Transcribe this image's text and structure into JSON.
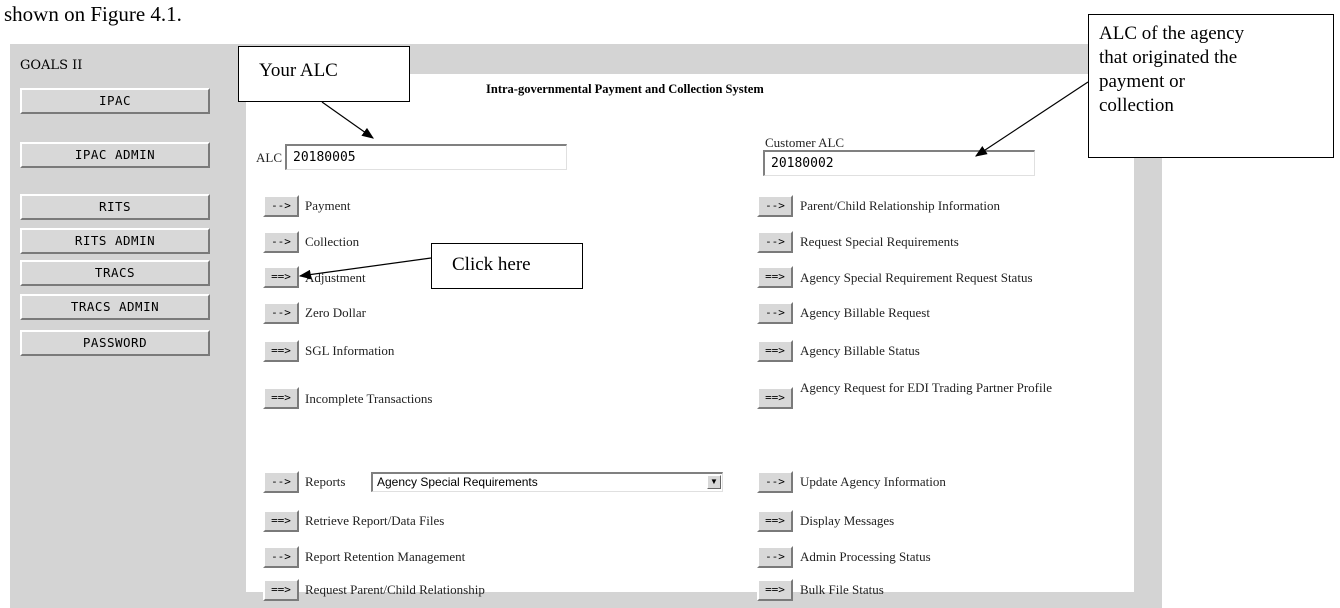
{
  "doc_text": "shown on Figure 4.1.",
  "app": {
    "name": "GOALS II",
    "title": "Intra-governmental Payment and Collection System"
  },
  "sidebar": [
    {
      "label": "IPAC"
    },
    {
      "label": "IPAC ADMIN"
    },
    {
      "label": "RITS"
    },
    {
      "label": "RITS ADMIN"
    },
    {
      "label": "TRACS"
    },
    {
      "label": "TRACS ADMIN"
    },
    {
      "label": "PASSWORD"
    }
  ],
  "form": {
    "alc_label": "ALC",
    "alc_value": "20180005",
    "customer_alc_label": "Customer ALC",
    "customer_alc_value": "20180002"
  },
  "left_items": [
    {
      "arrow": "-->",
      "label": "Payment"
    },
    {
      "arrow": "-->",
      "label": "Collection"
    },
    {
      "arrow": "==>",
      "label": "Adjustment"
    },
    {
      "arrow": "-->",
      "label": "Zero Dollar"
    },
    {
      "arrow": "==>",
      "label": "SGL Information"
    },
    {
      "arrow": "==>",
      "label": "Incomplete Transactions"
    },
    {
      "arrow": "-->",
      "label": "Reports"
    },
    {
      "arrow": "==>",
      "label": "Retrieve Report/Data Files"
    },
    {
      "arrow": "-->",
      "label": "Report Retention Management"
    },
    {
      "arrow": "==>",
      "label": "Request Parent/Child Relationship"
    }
  ],
  "reports_select": {
    "value": "Agency Special Requirements"
  },
  "right_items": [
    {
      "arrow": "-->",
      "label": "Parent/Child Relationship Information"
    },
    {
      "arrow": "-->",
      "label": "Request Special Requirements"
    },
    {
      "arrow": "==>",
      "label": "Agency Special Requirement Request Status"
    },
    {
      "arrow": "-->",
      "label": "Agency Billable Request"
    },
    {
      "arrow": "==>",
      "label": "Agency Billable Status"
    },
    {
      "arrow": "==>",
      "label": "Agency Request for EDI Trading Partner Profile"
    },
    {
      "arrow": "-->",
      "label": "Update Agency Information"
    },
    {
      "arrow": "==>",
      "label": "Display Messages"
    },
    {
      "arrow": "-->",
      "label": "Admin Processing Status"
    },
    {
      "arrow": "==>",
      "label": "Bulk File Status"
    }
  ],
  "callouts": {
    "your_alc": "Your ALC",
    "click_here": "Click here",
    "agency_alc_l1": "ALC of the agency",
    "agency_alc_l2": "that originated the",
    "agency_alc_l3": "payment or",
    "agency_alc_l4": "collection"
  }
}
